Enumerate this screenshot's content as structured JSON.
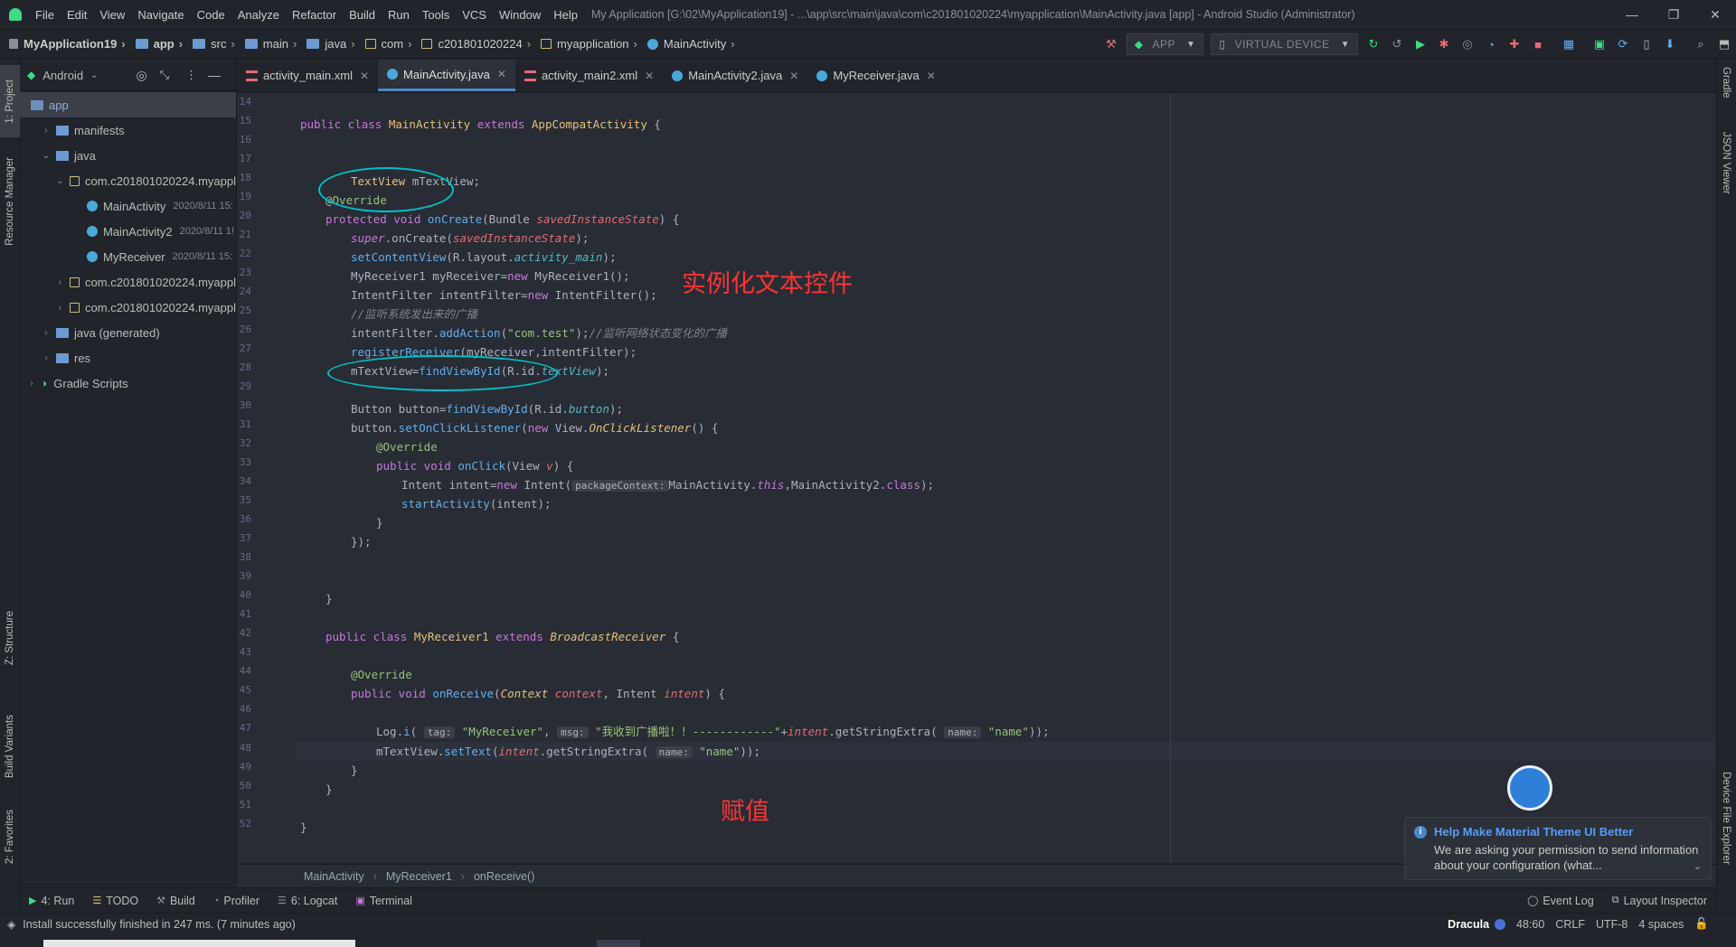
{
  "window": {
    "menu": [
      "File",
      "Edit",
      "View",
      "Navigate",
      "Code",
      "Analyze",
      "Refactor",
      "Build",
      "Run",
      "Tools",
      "VCS",
      "Window",
      "Help"
    ],
    "title": "My Application [G:\\02\\MyApplication19] - ...\\app\\src\\main\\java\\com\\c201801020224\\myapplication\\MainActivity.java [app] - Android Studio (Administrator)"
  },
  "nav": {
    "crumbs": [
      "MyApplication19",
      "app",
      "src",
      "main",
      "java",
      "com",
      "c201801020224",
      "myapplication",
      "MainActivity"
    ],
    "run_config": "APP",
    "device": "VIRTUAL DEVICE"
  },
  "left_strip": {
    "project": "1: Project",
    "resource_manager": "Resource Manager",
    "structure": "Z: Structure",
    "build_variants": "Build Variants",
    "favorites": "2: Favorites"
  },
  "right_strip": {
    "gradle": "Gradle",
    "json_viewer": "JSON Viewer",
    "device_file_explorer": "Device File Explorer"
  },
  "project_panel": {
    "view_mode": "Android",
    "items": [
      {
        "label": "app",
        "date": ""
      },
      {
        "label": "manifests",
        "date": ""
      },
      {
        "label": "java",
        "date": ""
      },
      {
        "label": "com.c201801020224.myappl",
        "date": ""
      },
      {
        "label": "MainActivity",
        "date": "2020/8/11 15:"
      },
      {
        "label": "MainActivity2",
        "date": "2020/8/11 1!"
      },
      {
        "label": "MyReceiver",
        "date": "2020/8/11 15:"
      },
      {
        "label": "com.c201801020224.myappl",
        "date": ""
      },
      {
        "label": "com.c201801020224.myappl",
        "date": ""
      },
      {
        "label": "java (generated)",
        "date": ""
      },
      {
        "label": "res",
        "date": ""
      },
      {
        "label": "Gradle Scripts",
        "date": ""
      }
    ]
  },
  "tabs": [
    "activity_main.xml",
    "MainActivity.java",
    "activity_main2.xml",
    "MainActivity2.java",
    "MyReceiver.java"
  ],
  "editor": {
    "line_numbers": [
      "14",
      "15",
      "16",
      "17",
      "18",
      "19",
      "20",
      "21",
      "22",
      "23",
      "24",
      "25",
      "26",
      "27",
      "28",
      "29",
      "30",
      "31",
      "32",
      "33",
      "34",
      "35",
      "36",
      "37",
      "38",
      "39",
      "40",
      "41",
      "42",
      "43",
      "44",
      "45",
      "46",
      "47",
      "48",
      "49",
      "50",
      "51",
      "52"
    ],
    "annotation_1": "实例化文本控件",
    "annotation_2": "赋值",
    "code": {
      "l15a": "public class ",
      "l15b": "MainActivity ",
      "l15c": "extends ",
      "l15d": "AppCompatActivity",
      "l15e": " {",
      "l18a": "TextView ",
      "l18b": "mTextView;",
      "l19": "@Override",
      "l20a": "protected void ",
      "l20b": "onCreate",
      "l20c": "(Bundle ",
      "l20d": "savedInstanceState",
      "l20e": ") {",
      "l21a": "super",
      "l21b": ".onCreate(",
      "l21c": "savedInstanceState",
      "l21d": ");",
      "l22a": "setContentView",
      "l22b": "(R.layout.",
      "l22c": "activity_main",
      "l22d": ");",
      "l23a": "MyReceiver1 myReceiver=",
      "l23b": "new ",
      "l23c": "MyReceiver1",
      "l23d": "();",
      "l24a": "IntentFilter intentFilter=",
      "l24b": "new ",
      "l24c": "IntentFilter",
      "l24d": "();",
      "l25": "//监听系统发出来的广播",
      "l26a": "intentFilter.",
      "l26b": "addAction",
      "l26c": "(",
      "l26d": "\"com.test\"",
      "l26e": ");",
      "l26f": "//监听网络状态变化的广播",
      "l27a": "registerReceiver",
      "l27b": "(myReceiver,intentFilter);",
      "l28a": "mTextView=",
      "l28b": "findViewById",
      "l28c": "(R.id.",
      "l28d": "textView",
      "l28e": ");",
      "l30a": "Button button=",
      "l30b": "findViewById",
      "l30c": "(R.id.",
      "l30d": "button",
      "l30e": ");",
      "l31a": "button.",
      "l31b": "setOnClickListener",
      "l31c": "(",
      "l31d": "new ",
      "l31e": "View.",
      "l31f": "OnClickListener",
      "l31g": "() {",
      "l32": "@Override",
      "l33a": "public void ",
      "l33b": "onClick",
      "l33c": "(View ",
      "l33d": "v",
      "l33e": ") {",
      "l34a": "Intent intent=",
      "l34b": "new ",
      "l34c": "Intent(",
      "l34h": "packageContext:",
      "l34d": "MainActivity.",
      "l34e": "this",
      "l34f": ",MainActivity2.",
      "l34g": "class",
      "l34i": ");",
      "l35a": "startActivity",
      "l35b": "(intent);",
      "l36": "}",
      "l37": "});",
      "l40": "}",
      "l42a": "public class ",
      "l42b": "MyReceiver1 ",
      "l42c": "extends ",
      "l42d": "BroadcastReceiver",
      "l42e": " {",
      "l44": "@Override",
      "l45a": "public void ",
      "l45b": "onReceive",
      "l45c": "(",
      "l45d": "Context ",
      "l45e": "context",
      "l45f": ", Intent ",
      "l45g": "intent",
      "l45h": ") {",
      "l47a": "Log.",
      "l47b": "i",
      "l47c": "( ",
      "l47h1": "tag:",
      "l47d": "\"MyReceiver\"",
      "l47e": ", ",
      "l47h2": "msg:",
      "l47f": "\"我收到广播啦！！------------\"",
      "l47g": "+",
      "l47i": "intent",
      "l47j": ".getStringExtra( ",
      "l47h3": "name:",
      "l47k": "\"name\"",
      "l47l": "));",
      "l48a": "mTextView.",
      "l48b": "setText",
      "l48c": "(",
      "l48d": "intent",
      "l48e": ".getStringExtra( ",
      "l48h": "name:",
      "l48f": "\"name\"",
      "l48g": "));",
      "l49": "}",
      "l50": "}",
      "l52": "}"
    }
  },
  "code_breadcrumb": [
    "MainActivity",
    "MyReceiver1",
    "onReceive()"
  ],
  "bottom_tools": [
    "4: Run",
    "TODO",
    "Build",
    "Profiler",
    "6: Logcat",
    "Terminal"
  ],
  "bottom_right_tools": [
    "Event Log",
    "Layout Inspector"
  ],
  "status": {
    "message": "Install successfully finished in 247 ms. (7 minutes ago)",
    "theme": "Dracula",
    "position": "48:60",
    "line_sep": "CRLF",
    "encoding": "UTF-8",
    "indent": "4 spaces"
  },
  "notification": {
    "title": "Help Make Material Theme UI Better",
    "body": "We are asking your permission to send information about your configuration (what..."
  }
}
